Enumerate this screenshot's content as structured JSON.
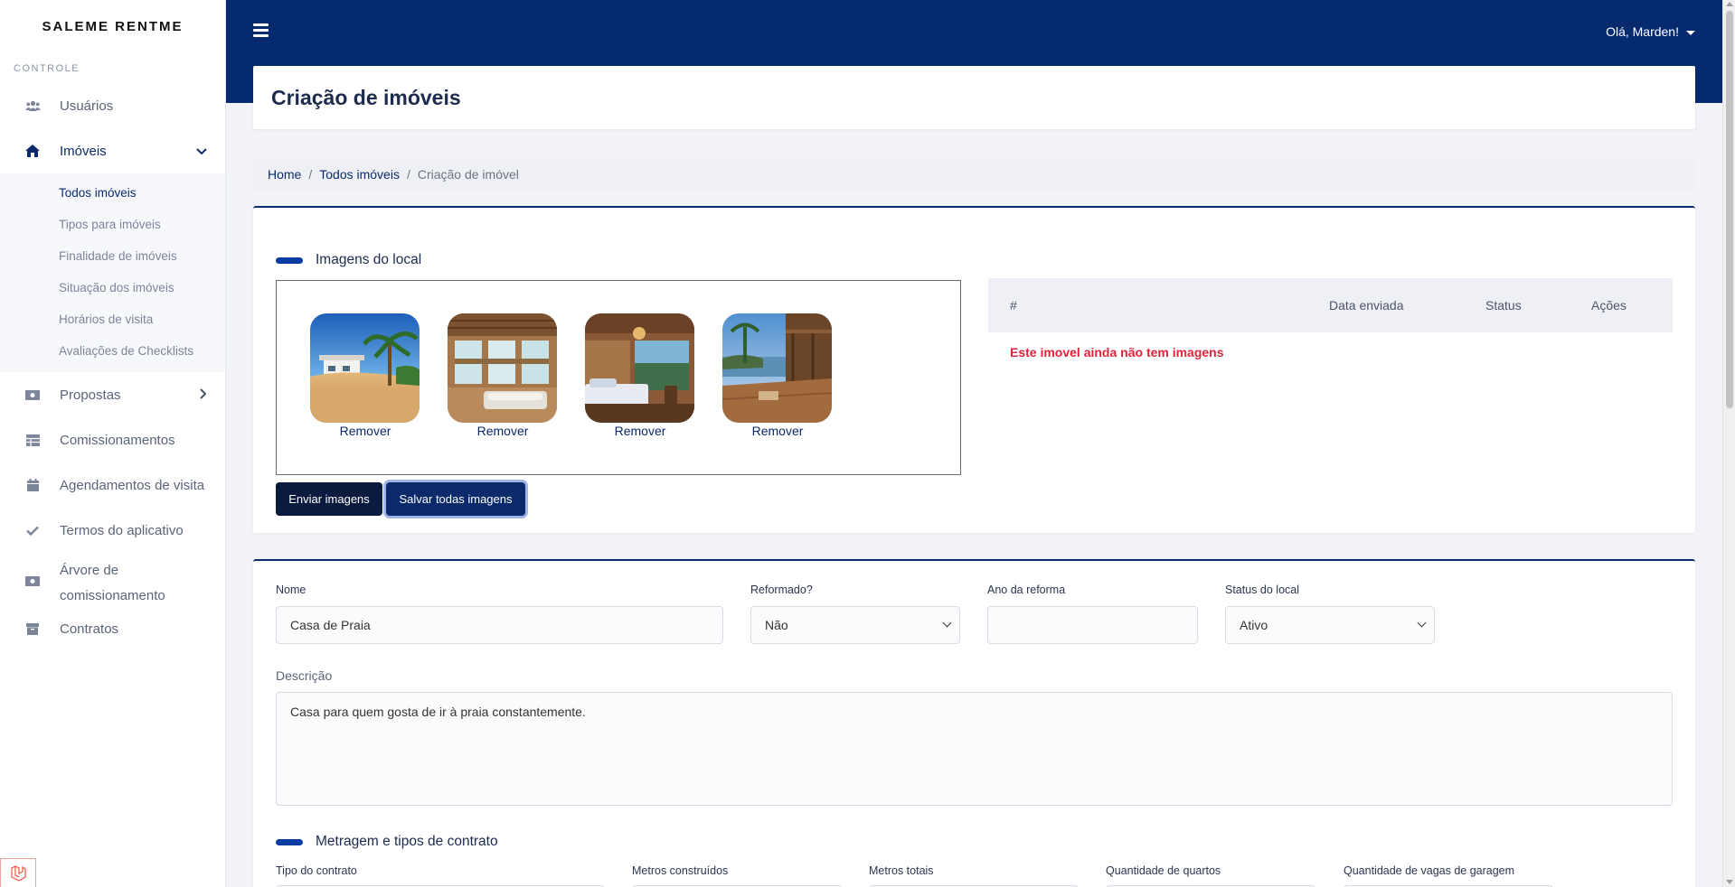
{
  "sidebar": {
    "brand": "SALEME RENTME",
    "section_label": "CONTROLE",
    "items": [
      {
        "label": "Usuários",
        "icon": "users-icon"
      },
      {
        "label": "Imóveis",
        "icon": "home-icon"
      },
      {
        "label": "Propostas",
        "icon": "money-icon"
      },
      {
        "label": "Comissionamentos",
        "icon": "table-icon"
      },
      {
        "label": "Agendamentos de visita",
        "icon": "calendar-icon"
      },
      {
        "label": "Termos do aplicativo",
        "icon": "check-icon"
      },
      {
        "label": "Árvore de comissionamento",
        "icon": "money-icon"
      },
      {
        "label": "Contratos",
        "icon": "archive-icon"
      }
    ],
    "imoveis_sub": [
      {
        "label": "Todos imóveis"
      },
      {
        "label": "Tipos para imóveis"
      },
      {
        "label": "Finalidade de imóveis"
      },
      {
        "label": "Situação dos imóveis"
      },
      {
        "label": "Horários de visita"
      },
      {
        "label": "Avaliações de Checklists"
      }
    ]
  },
  "topbar": {
    "user_greeting": "Olá, Marden!",
    "bg_color": "#052b6e"
  },
  "page": {
    "title": "Criação de imóveis"
  },
  "breadcrumb": {
    "home": "Home",
    "all": "Todos imóveis",
    "current": "Criação de imóvel",
    "separator": "/"
  },
  "images_section": {
    "title": "Imagens do local",
    "thumbnails": [
      {
        "remove_label": "Remover",
        "scene": "beach-house"
      },
      {
        "remove_label": "Remover",
        "scene": "veranda-interior"
      },
      {
        "remove_label": "Remover",
        "scene": "bedroom-sea-view"
      },
      {
        "remove_label": "Remover",
        "scene": "deck-sunset"
      }
    ],
    "send_button": "Enviar imagens",
    "save_all_button": "Salvar todas imagens",
    "table": {
      "headers": [
        "#",
        "Data enviada",
        "Status",
        "Ações"
      ],
      "empty_message": "Este imovel ainda não tem imagens"
    }
  },
  "form": {
    "nome_label": "Nome",
    "nome_value": "Casa de Praia",
    "reformado_label": "Reformado?",
    "reformado_value": "Não",
    "ano_label": "Ano da reforma",
    "ano_value": "",
    "status_label": "Status do local",
    "status_value": "Ativo",
    "descricao_label": "Descrição",
    "descricao_value": "Casa para quem gosta de ir à praia constantemente.",
    "metragem_title": "Metragem e tipos de contrato",
    "tipo_contrato_label": "Tipo do contrato",
    "metros_construidos_label": "Metros construídos",
    "metros_totais_label": "Metros totais",
    "quartos_label": "Quantidade de quartos",
    "vagas_label": "Quantidade de vagas de garagem"
  },
  "colors": {
    "primary": "#0b2a6b",
    "error": "#e0243b"
  }
}
